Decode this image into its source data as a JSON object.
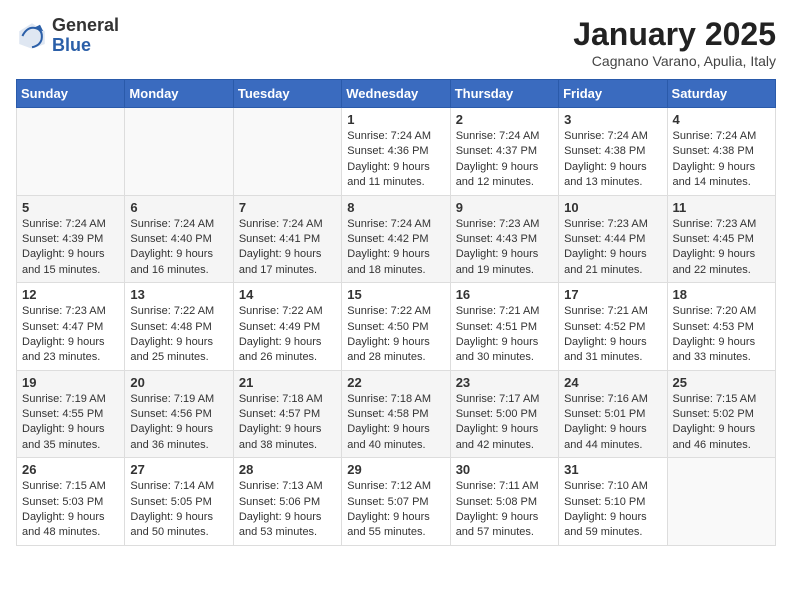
{
  "header": {
    "logo_general": "General",
    "logo_blue": "Blue",
    "month_year": "January 2025",
    "location": "Cagnano Varano, Apulia, Italy"
  },
  "days_of_week": [
    "Sunday",
    "Monday",
    "Tuesday",
    "Wednesday",
    "Thursday",
    "Friday",
    "Saturday"
  ],
  "weeks": [
    [
      {
        "day": "",
        "info": ""
      },
      {
        "day": "",
        "info": ""
      },
      {
        "day": "",
        "info": ""
      },
      {
        "day": "1",
        "info": "Sunrise: 7:24 AM\nSunset: 4:36 PM\nDaylight: 9 hours\nand 11 minutes."
      },
      {
        "day": "2",
        "info": "Sunrise: 7:24 AM\nSunset: 4:37 PM\nDaylight: 9 hours\nand 12 minutes."
      },
      {
        "day": "3",
        "info": "Sunrise: 7:24 AM\nSunset: 4:38 PM\nDaylight: 9 hours\nand 13 minutes."
      },
      {
        "day": "4",
        "info": "Sunrise: 7:24 AM\nSunset: 4:38 PM\nDaylight: 9 hours\nand 14 minutes."
      }
    ],
    [
      {
        "day": "5",
        "info": "Sunrise: 7:24 AM\nSunset: 4:39 PM\nDaylight: 9 hours\nand 15 minutes."
      },
      {
        "day": "6",
        "info": "Sunrise: 7:24 AM\nSunset: 4:40 PM\nDaylight: 9 hours\nand 16 minutes."
      },
      {
        "day": "7",
        "info": "Sunrise: 7:24 AM\nSunset: 4:41 PM\nDaylight: 9 hours\nand 17 minutes."
      },
      {
        "day": "8",
        "info": "Sunrise: 7:24 AM\nSunset: 4:42 PM\nDaylight: 9 hours\nand 18 minutes."
      },
      {
        "day": "9",
        "info": "Sunrise: 7:23 AM\nSunset: 4:43 PM\nDaylight: 9 hours\nand 19 minutes."
      },
      {
        "day": "10",
        "info": "Sunrise: 7:23 AM\nSunset: 4:44 PM\nDaylight: 9 hours\nand 21 minutes."
      },
      {
        "day": "11",
        "info": "Sunrise: 7:23 AM\nSunset: 4:45 PM\nDaylight: 9 hours\nand 22 minutes."
      }
    ],
    [
      {
        "day": "12",
        "info": "Sunrise: 7:23 AM\nSunset: 4:47 PM\nDaylight: 9 hours\nand 23 minutes."
      },
      {
        "day": "13",
        "info": "Sunrise: 7:22 AM\nSunset: 4:48 PM\nDaylight: 9 hours\nand 25 minutes."
      },
      {
        "day": "14",
        "info": "Sunrise: 7:22 AM\nSunset: 4:49 PM\nDaylight: 9 hours\nand 26 minutes."
      },
      {
        "day": "15",
        "info": "Sunrise: 7:22 AM\nSunset: 4:50 PM\nDaylight: 9 hours\nand 28 minutes."
      },
      {
        "day": "16",
        "info": "Sunrise: 7:21 AM\nSunset: 4:51 PM\nDaylight: 9 hours\nand 30 minutes."
      },
      {
        "day": "17",
        "info": "Sunrise: 7:21 AM\nSunset: 4:52 PM\nDaylight: 9 hours\nand 31 minutes."
      },
      {
        "day": "18",
        "info": "Sunrise: 7:20 AM\nSunset: 4:53 PM\nDaylight: 9 hours\nand 33 minutes."
      }
    ],
    [
      {
        "day": "19",
        "info": "Sunrise: 7:19 AM\nSunset: 4:55 PM\nDaylight: 9 hours\nand 35 minutes."
      },
      {
        "day": "20",
        "info": "Sunrise: 7:19 AM\nSunset: 4:56 PM\nDaylight: 9 hours\nand 36 minutes."
      },
      {
        "day": "21",
        "info": "Sunrise: 7:18 AM\nSunset: 4:57 PM\nDaylight: 9 hours\nand 38 minutes."
      },
      {
        "day": "22",
        "info": "Sunrise: 7:18 AM\nSunset: 4:58 PM\nDaylight: 9 hours\nand 40 minutes."
      },
      {
        "day": "23",
        "info": "Sunrise: 7:17 AM\nSunset: 5:00 PM\nDaylight: 9 hours\nand 42 minutes."
      },
      {
        "day": "24",
        "info": "Sunrise: 7:16 AM\nSunset: 5:01 PM\nDaylight: 9 hours\nand 44 minutes."
      },
      {
        "day": "25",
        "info": "Sunrise: 7:15 AM\nSunset: 5:02 PM\nDaylight: 9 hours\nand 46 minutes."
      }
    ],
    [
      {
        "day": "26",
        "info": "Sunrise: 7:15 AM\nSunset: 5:03 PM\nDaylight: 9 hours\nand 48 minutes."
      },
      {
        "day": "27",
        "info": "Sunrise: 7:14 AM\nSunset: 5:05 PM\nDaylight: 9 hours\nand 50 minutes."
      },
      {
        "day": "28",
        "info": "Sunrise: 7:13 AM\nSunset: 5:06 PM\nDaylight: 9 hours\nand 53 minutes."
      },
      {
        "day": "29",
        "info": "Sunrise: 7:12 AM\nSunset: 5:07 PM\nDaylight: 9 hours\nand 55 minutes."
      },
      {
        "day": "30",
        "info": "Sunrise: 7:11 AM\nSunset: 5:08 PM\nDaylight: 9 hours\nand 57 minutes."
      },
      {
        "day": "31",
        "info": "Sunrise: 7:10 AM\nSunset: 5:10 PM\nDaylight: 9 hours\nand 59 minutes."
      },
      {
        "day": "",
        "info": ""
      }
    ]
  ]
}
